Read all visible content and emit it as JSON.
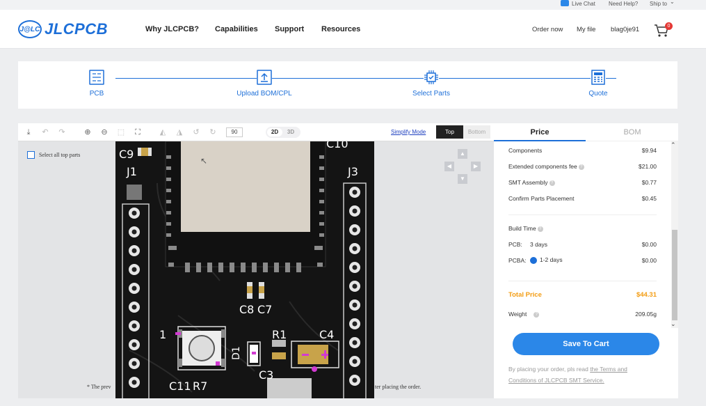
{
  "topbar": {
    "live_chat": "Live Chat",
    "need_help": "Need Help?",
    "ship_to": "Ship to"
  },
  "header": {
    "logo_badge": "J@LC",
    "logo_name": "JLCPCB",
    "nav": [
      "Why JLCPCB?",
      "Capabilities",
      "Support",
      "Resources"
    ],
    "order_now": "Order now",
    "my_file": "My file",
    "username": "blag0je91",
    "cart_count": "0"
  },
  "steps": [
    {
      "label": "PCB",
      "icon": "pcb-icon"
    },
    {
      "label": "Upload BOM/CPL",
      "icon": "upload-icon"
    },
    {
      "label": "Select Parts",
      "icon": "chip-icon"
    },
    {
      "label": "Quote",
      "icon": "calculator-icon"
    }
  ],
  "toolbar": {
    "rotation": "90",
    "dim_2d": "2D",
    "dim_3d": "3D",
    "simplify": "Simplify Mode",
    "side_top": "Top",
    "side_bottom": "Bottom"
  },
  "viewer": {
    "select_all": "Select all top parts",
    "note_left": "* The prev",
    "note_right": "ter placing the order."
  },
  "pcb_labels": [
    "C9",
    "J1",
    "C10",
    "J3",
    "C8",
    "C7",
    "R1",
    "C4",
    "1",
    "D1",
    "C3",
    "C11",
    "R7"
  ],
  "panel": {
    "tab_price": "Price",
    "tab_bom": "BOM",
    "components_label": "Components",
    "components_value": "$9.94",
    "extended_label": "Extended components fee",
    "extended_value": "$21.00",
    "smt_label": "SMT Assembly",
    "smt_value": "$0.77",
    "confirm_label": "Confirm Parts Placement",
    "confirm_value": "$0.45",
    "build_time_label": "Build Time",
    "pcb_label": "PCB:",
    "pcb_days": "3 days",
    "pcb_value": "$0.00",
    "pcba_label": "PCBA:",
    "pcba_days": "1-2 days",
    "pcba_value": "$0.00",
    "total_label": "Total Price",
    "total_value": "$44.31",
    "weight_label": "Weight",
    "weight_value": "209.05g",
    "save_button": "Save To Cart",
    "terms_prefix": "By placing your order, pls read",
    "terms_link": "the Terms and Conditions of JLCPCB SMT Service."
  },
  "colors": {
    "accent": "#1d6fd8",
    "total": "#f39c12",
    "button": "#2b87e8",
    "board": "#141414"
  }
}
